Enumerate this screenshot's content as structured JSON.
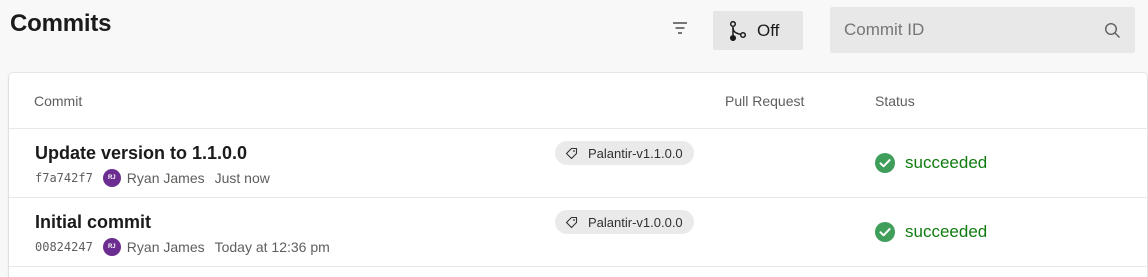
{
  "page": {
    "title": "Commits"
  },
  "toolbar": {
    "graph_toggle_label": "Off",
    "search_placeholder": "Commit ID"
  },
  "table": {
    "columns": {
      "commit": "Commit",
      "pull_request": "Pull Request",
      "status": "Status"
    },
    "rows": [
      {
        "title": "Update version to 1.1.0.0",
        "hash": "f7a742f7",
        "avatar": "RJ",
        "author": "Ryan James",
        "time": "Just now",
        "tag": "Palantir-v1.1.0.0",
        "status": "succeeded"
      },
      {
        "title": "Initial commit",
        "hash": "00824247",
        "avatar": "RJ",
        "author": "Ryan James",
        "time": "Today at 12:36 pm",
        "tag": "Palantir-v1.0.0.0",
        "status": "succeeded"
      }
    ]
  },
  "colors": {
    "success": "#107c10",
    "avatar": "#6b2d8f",
    "background": "#f8f8f8"
  },
  "icons": [
    "filter-icon",
    "branch-graph-icon",
    "search-icon",
    "tag-icon",
    "check-circle-icon"
  ]
}
